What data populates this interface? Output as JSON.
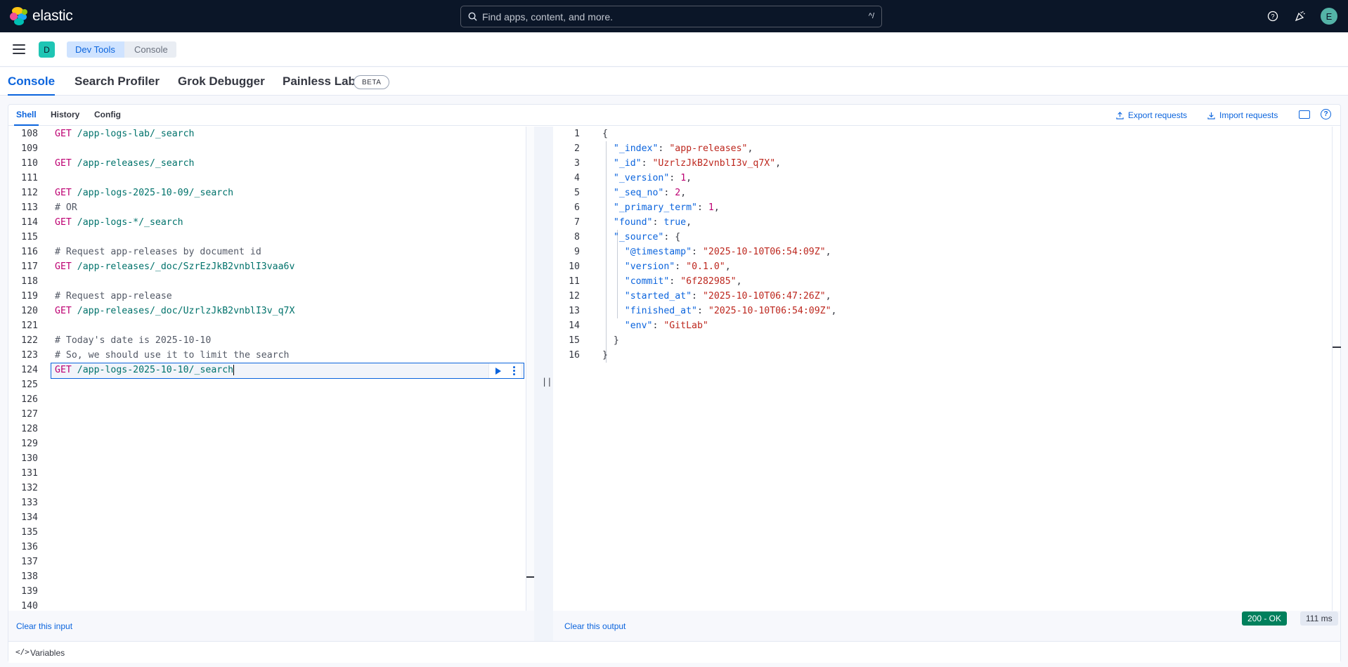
{
  "header": {
    "logo_text": "elastic",
    "search_placeholder": "Find apps, content, and more.",
    "search_shortcut": "^/",
    "avatar_initial": "E",
    "icons": [
      "help-icon",
      "news-icon"
    ]
  },
  "breadcrumbs": {
    "space_initial": "D",
    "items": [
      "Dev Tools",
      "Console"
    ]
  },
  "app_tabs": [
    "Console",
    "Search Profiler",
    "Grok Debugger",
    "Painless Lab"
  ],
  "beta_badge": "BETA",
  "console_tabs": [
    "Shell",
    "History",
    "Config"
  ],
  "actions": {
    "export": "Export requests",
    "import": "Import requests"
  },
  "editor": {
    "line_numbers": [
      "108",
      "109",
      "110",
      "111",
      "112",
      "113",
      "114",
      "115",
      "116",
      "117",
      "118",
      "119",
      "120",
      "121",
      "122",
      "123",
      "124",
      "125",
      "126",
      "127",
      "128",
      "129",
      "130",
      "131",
      "132",
      "133",
      "134",
      "135",
      "136",
      "137",
      "138",
      "139",
      "140"
    ],
    "lines": [
      {
        "method": "GET",
        "path": " /app-logs-lab/_search"
      },
      {
        "text": ""
      },
      {
        "method": "GET",
        "path": " /app-releases/_search"
      },
      {
        "text": ""
      },
      {
        "method": "GET",
        "path": " /app-logs-2025-10-09/_search"
      },
      {
        "comment": "# OR"
      },
      {
        "method": "GET",
        "path": " /app-logs-*/_search"
      },
      {
        "text": ""
      },
      {
        "comment": "# Request app-releases by document id"
      },
      {
        "method": "GET",
        "path": " /app-releases/_doc/SzrEzJkB2vnblI3vaa6v"
      },
      {
        "text": ""
      },
      {
        "comment": "# Request app-release"
      },
      {
        "method": "GET",
        "path": " /app-releases/_doc/UzrlzJkB2vnblI3v_q7X"
      },
      {
        "text": ""
      },
      {
        "comment": "# Today's date is 2025-10-10"
      },
      {
        "comment": "# So, we should use it to limit the search"
      },
      {
        "method": "GET",
        "path": " /app-logs-2025-10-10/_search"
      }
    ]
  },
  "output": {
    "line_numbers": [
      "1",
      "2",
      "3",
      "4",
      "5",
      "6",
      "7",
      "8",
      "9",
      "10",
      "11",
      "12",
      "13",
      "14",
      "15",
      "16"
    ],
    "index": "\"app-releases\"",
    "id": "\"UzrlzJkB2vnblI3v_q7X\"",
    "version": "1",
    "seq_no": "2",
    "primary_term": "1",
    "found": "true",
    "timestamp": "\"2025-10-10T06:54:09Z\"",
    "src_version": "\"0.1.0\"",
    "commit": "\"6f282985\"",
    "started_at": "\"2025-10-10T06:47:26Z\"",
    "finished_at": "\"2025-10-10T06:54:09Z\"",
    "env": "\"GitLab\""
  },
  "footer": {
    "clear_input": "Clear this input",
    "clear_output": "Clear this output",
    "status": "200 - OK",
    "time": "111 ms",
    "variables": "Variables",
    "variables_icon": "</>"
  },
  "colors": {
    "header_bg": "#0b1628",
    "accent": "#0b64dd",
    "status_ok": "#00805c"
  }
}
